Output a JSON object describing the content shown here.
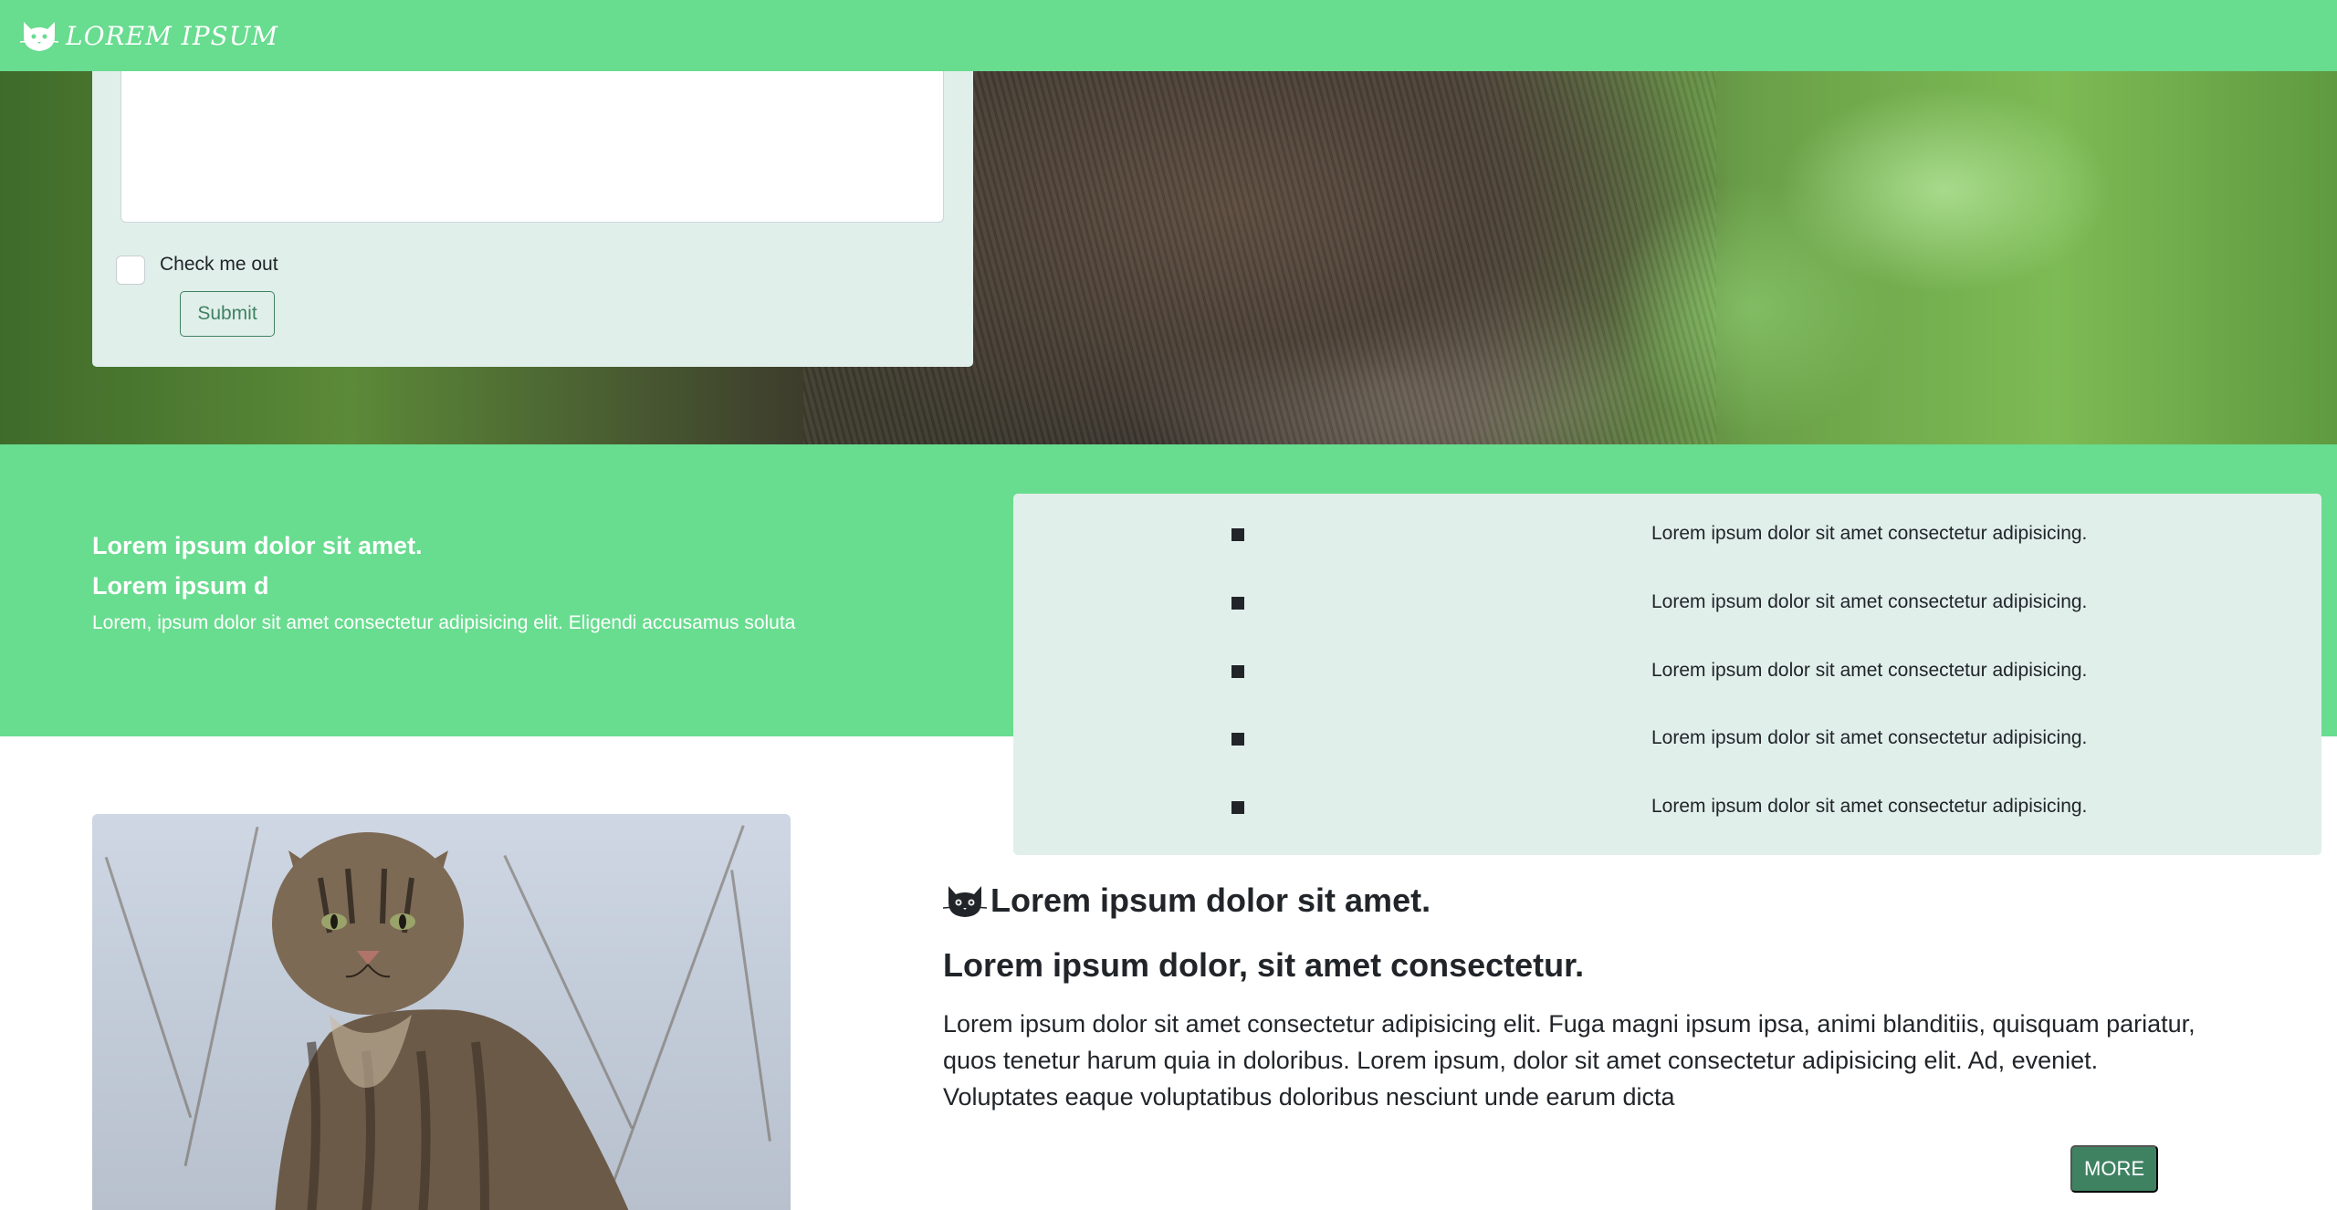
{
  "navbar": {
    "brand_text": "LOREM IPSUM",
    "logo_icon": "cat-icon",
    "background": "#68dc8f"
  },
  "form": {
    "checkbox_label": "Check me out",
    "checkbox_checked": false,
    "submit_label": "Submit"
  },
  "band": {
    "heading": "Lorem ipsum dolor sit amet.",
    "subheading": "Lorem ipsum d",
    "paragraph": "Lorem, ipsum dolor sit amet consectetur adipisicing elit. Eligendi accusamus soluta"
  },
  "list": {
    "items": [
      {
        "label": "Lorem ipsum dolor sit amet consectetur adipisicing."
      },
      {
        "label": "Lorem ipsum dolor sit amet consectetur adipisicing."
      },
      {
        "label": "Lorem ipsum dolor sit amet consectetur adipisicing."
      },
      {
        "label": "Lorem ipsum dolor sit amet consectetur adipisicing."
      },
      {
        "label": "Lorem ipsum dolor sit amet consectetur adipisicing."
      }
    ]
  },
  "article": {
    "title_icon": "cat-icon",
    "title": "Lorem ipsum dolor sit amet.",
    "subtitle": "Lorem ipsum dolor, sit amet consectetur.",
    "body": "Lorem ipsum dolor sit amet consectetur adipisicing elit. Fuga magni ipsum ipsa, animi blanditiis, quisquam pariatur, quos tenetur harum quia in doloribus. Lorem ipsum, dolor sit amet consectetur adipisicing elit. Ad, eveniet. Voluptates eaque voluptatibus doloribus nesciunt unde earum dicta",
    "more_label": "MORE"
  },
  "colors": {
    "accent_green": "#68dc8f",
    "card_bg": "#e1efeb",
    "button_green": "#3f8262"
  }
}
